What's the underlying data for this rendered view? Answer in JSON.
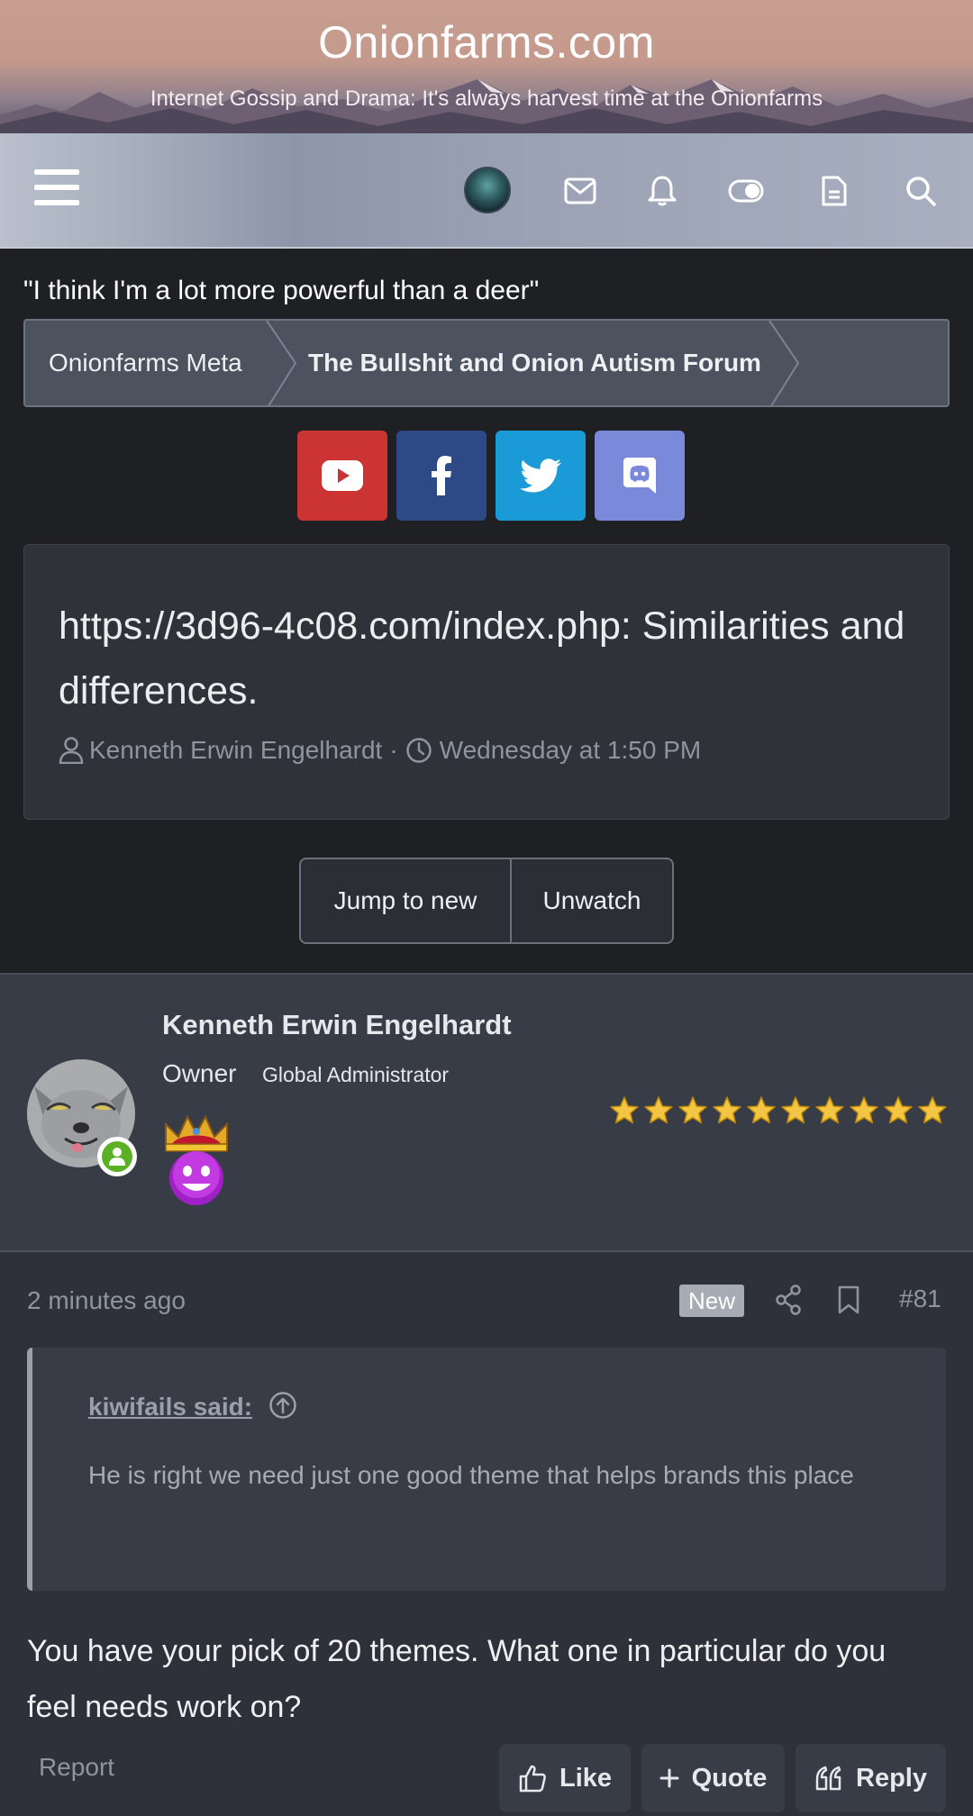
{
  "site": {
    "title": "Onionfarms.com",
    "tagline": "Internet Gossip and Drama: It's always harvest time at the Onionfarms"
  },
  "navbar": {
    "icons": [
      "menu-icon",
      "user-avatar",
      "mail-icon",
      "bell-icon",
      "toggle-icon",
      "document-icon",
      "search-icon"
    ]
  },
  "quote_of_day": "\"I think I'm a lot more powerful than a deer\"",
  "breadcrumb": {
    "items": [
      "Onionfarms Meta",
      "The Bullshit and Onion Autism Forum"
    ]
  },
  "social": [
    "youtube-icon",
    "facebook-icon",
    "twitter-icon",
    "discord-icon"
  ],
  "colors": {
    "youtube": "#cc3333",
    "facebook": "#2d4a86",
    "twitter": "#1a9ad6",
    "discord": "#7a89d9",
    "online": "#5cb025"
  },
  "thread": {
    "title": "https://3d96-4c08.com/index.php: Similarities and differences.",
    "author": "Kenneth Erwin Engelhardt",
    "separator": "·",
    "date": "Wednesday at 1:50 PM"
  },
  "thread_actions": {
    "jump": "Jump to new",
    "unwatch": "Unwatch"
  },
  "post": {
    "username": "Kenneth Erwin Engelhardt",
    "user_title": "Owner",
    "user_banner": "Global Administrator",
    "stars": 10,
    "time": "2 minutes ago",
    "badge": "New",
    "number": "#81",
    "quote": {
      "author": "kiwifails said:",
      "text": "He is right we need just one good theme that helps brands this place"
    },
    "text": "You have your pick of 20 themes. What one in particular do you feel needs work on?",
    "report": "Report",
    "actions": {
      "like": "Like",
      "quote": "Quote",
      "reply": "Reply"
    }
  }
}
